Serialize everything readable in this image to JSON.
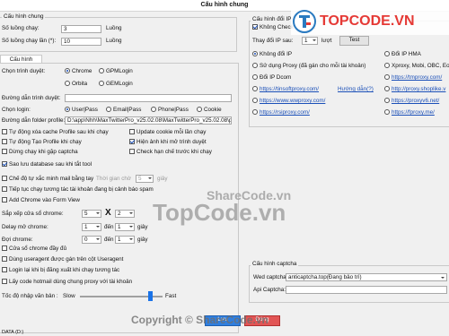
{
  "window": {
    "title": "Cấu hình chung"
  },
  "general": {
    "group_title": "Cấu hình chung",
    "threads_label": "Số luồng chạy:",
    "threads_value": "3",
    "threads_unit": "Luồng",
    "max_threads_label": "Số luồng chạy lần (*):",
    "max_threads_value": "10",
    "max_threads_unit": "Luồng"
  },
  "chrome": {
    "tab_label": "Cấu hình Chrome",
    "browser_label": "Chọn trình duyệt:",
    "browsers": [
      "Chrome",
      "GPMLogin",
      "Orbita",
      "GEMLogin"
    ],
    "browser_path_label": "Đường dẫn trình duyệt:",
    "browser_path_value": "",
    "login_type_label": "Chọn login:",
    "login_types": [
      "User|Pass",
      "Email|Pass",
      "Phone|Pass",
      "Cookie"
    ],
    "folder_label": "Đường dẫn folder profile:",
    "folder_value": "D:\\app\\Nhh\\MaxTwitterPro_v25.02.08\\MaxTwitterPro_v25.02.08\\profiles",
    "options_left": [
      {
        "label": "Tự động xóa cache Profile sau khi chạy",
        "checked": false
      },
      {
        "label": "Tự động Tạo Profile khi chạy",
        "checked": false
      },
      {
        "label": "Dừng chạy khi gặp captcha",
        "checked": false
      },
      {
        "label": "Sao lưu database sau khi tắt tool",
        "checked": true
      }
    ],
    "options_right": [
      {
        "label": "Update cookie mỗi lần chạy",
        "checked": false
      },
      {
        "label": "Hiện ảnh khi mở trình duyệt",
        "checked": true
      },
      {
        "label": "Check hạn chế trước khi chạy",
        "checked": false
      }
    ],
    "lowres_label": "Chế độ tự xắc minh mail bằng tay",
    "wait_label": "Thời gian chờ",
    "wait_value": "5",
    "wait_unit": "giây",
    "continue_label": "Tiếp tục chạy tương tác tài khoản đang bị cảnh báo spam",
    "formview_label": "Add Chrome vào Form View",
    "arrange_label": "Sắp xếp cửa sổ chrome:",
    "arrange_cols": "5",
    "arrange_x": "X",
    "arrange_rows": "2",
    "delay_label": "Delay mở chrome:",
    "delay_from": "1",
    "delay_to_label": "đến",
    "delay_to": "1",
    "delay_unit": "giây",
    "wait_chrome_label": "Đợi chrome:",
    "wait_from": "0",
    "wait_to_label": "đến",
    "wait_to": "1",
    "wait_chrome_unit": "giây",
    "fullwin_label": "Cửa sổ chrome đầy đủ",
    "useragent_label": "Dùng useragent được gán trên cột Useragent",
    "logout_label": "Login lại khi bị đăng xuất khi chạy tương tác",
    "hotmail_label": "Lấy code hotmail dùng chung proxy với tài khoản",
    "speed_label": "Tốc độ nhập văn bản :",
    "speed_slow": "Slow",
    "speed_fast": "Fast",
    "speed_level": 0.85
  },
  "ip": {
    "group_title": "Cấu hình đổi IP",
    "no_check_label": "Không Check IP trước",
    "change_after_label": "Thay đổi IP sau:",
    "change_after_value": "1",
    "change_after_unit": "lượt",
    "test_label": "Test",
    "options_left": [
      {
        "label": "Không đổi IP",
        "on": true,
        "link": false
      },
      {
        "label": "Sử dụng Proxy (đã gán cho mỗi tài khoản)",
        "on": false,
        "link": false
      },
      {
        "label": "Đổi IP Dcom",
        "on": false,
        "link": false
      },
      {
        "label": "https://tinsoftproxy.com/",
        "on": false,
        "link": true
      },
      {
        "label": "https://www.wwproxy.com/",
        "on": false,
        "link": true
      },
      {
        "label": "https://rsiproxy.com/",
        "on": false,
        "link": true
      }
    ],
    "guide_label": "Hướng dẫn(?)",
    "options_right": [
      {
        "label": "Đổi IP HMA",
        "on": false,
        "link": false
      },
      {
        "label": "Xproxy, Mobi, OBC, Eo",
        "on": false,
        "link": false
      },
      {
        "label": "https://tmproxy.com/",
        "on": false,
        "link": true
      },
      {
        "label": "http://proxy.shoplike.v",
        "on": false,
        "link": true
      },
      {
        "label": "https://proxyv6.net/",
        "on": false,
        "link": true
      },
      {
        "label": "https://fproxy.me/",
        "on": false,
        "link": true
      }
    ]
  },
  "captcha": {
    "group_title": "Cấu hình captcha",
    "web_label": "Wed captcha:",
    "web_value": "anticaptcha.top(Đang bảo trì)",
    "api_label": "Api Captcha:",
    "api_value": ""
  },
  "footer": {
    "save_label": "Lưu",
    "close_label": "Đóng",
    "bottom_text": "DATA (D:)"
  },
  "watermarks": {
    "logo_text": "TOPCODE.VN",
    "logo_icon": "topcode-logo-icon",
    "sharecode": "ShareCode.vn",
    "topcode": "TopCode.vn",
    "copyright": "Copyright © ShareCode.vn"
  }
}
